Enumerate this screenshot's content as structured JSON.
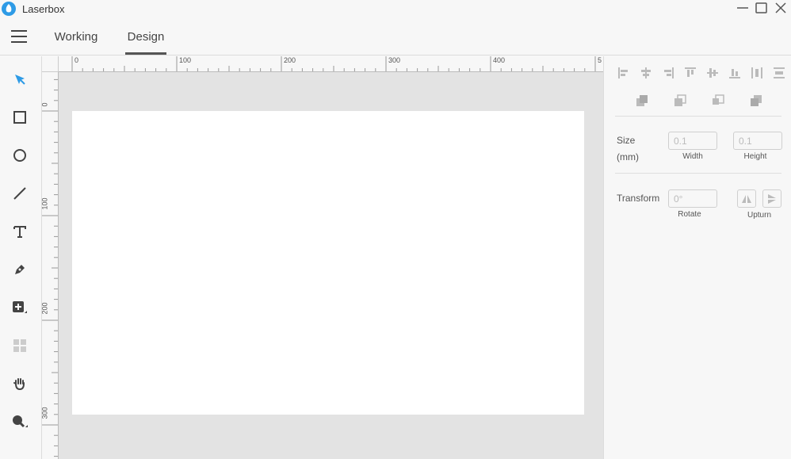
{
  "app": {
    "title": "Laserbox"
  },
  "tabs": [
    {
      "label": "Working"
    },
    {
      "label": "Design"
    }
  ],
  "active_tab": "Design",
  "ruler": {
    "top_labels": [
      "0",
      "100",
      "200",
      "300",
      "400",
      "5"
    ],
    "left_labels": [
      "0",
      "100",
      "200",
      "300"
    ]
  },
  "tools": [
    "select-icon",
    "rectangle-icon",
    "ellipse-icon",
    "line-icon",
    "text-icon",
    "pen-icon",
    "add-shape-icon",
    "grid-icon",
    "hand-icon",
    "zoom-icon"
  ],
  "panel": {
    "size": {
      "label_line1": "Size",
      "label_line2": "(mm)",
      "width_value": "0.1",
      "height_value": "0.1",
      "width_caption": "Width",
      "height_caption": "Height"
    },
    "transform": {
      "label": "Transform",
      "rotate_placeholder": "0°",
      "rotate_caption": "Rotate",
      "upturn_caption": "Upturn"
    }
  },
  "colors": {
    "accent": "#2e9be6",
    "select_tool": "#2e9be6",
    "canvas_bg": "#e3e3e3",
    "workarea": "#ffffff"
  }
}
